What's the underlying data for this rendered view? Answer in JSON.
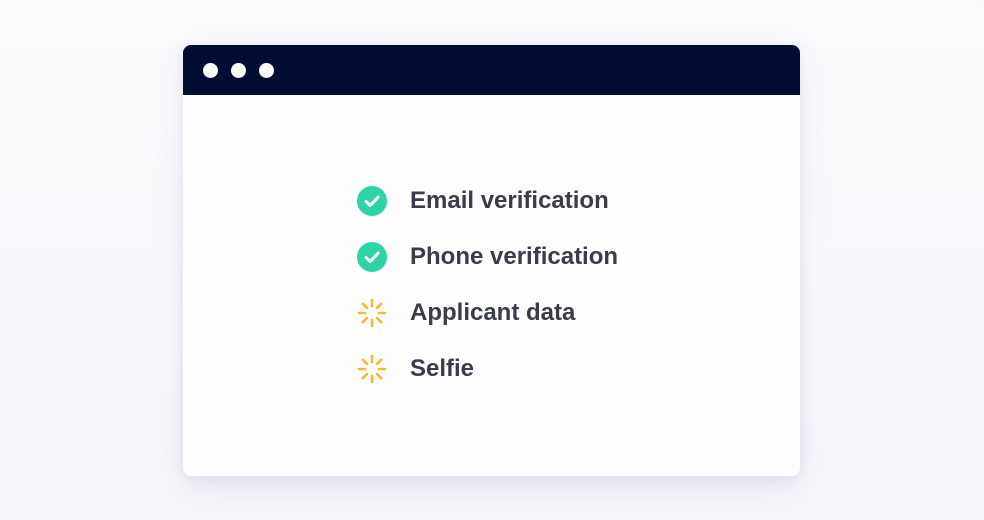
{
  "window": {
    "titlebar_color": "#020d33",
    "controls": [
      "window-dot",
      "window-dot",
      "window-dot"
    ]
  },
  "checklist": {
    "items": [
      {
        "label": "Email verification",
        "status": "complete",
        "icon": "check-circle-icon",
        "color": "#2dd4a8"
      },
      {
        "label": "Phone verification",
        "status": "complete",
        "icon": "check-circle-icon",
        "color": "#2dd4a8"
      },
      {
        "label": "Applicant data",
        "status": "pending",
        "icon": "loading-spinner-icon",
        "color": "#f5b731"
      },
      {
        "label": "Selfie",
        "status": "pending",
        "icon": "loading-spinner-icon",
        "color": "#f5b731"
      }
    ]
  }
}
